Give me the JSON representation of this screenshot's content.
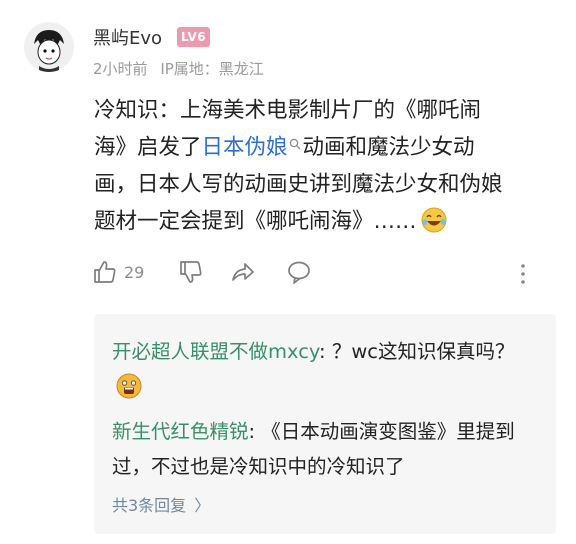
{
  "comment": {
    "username": "黑屿Evo",
    "level_badge": "LV6",
    "time": "2小时前",
    "ip_location": "IP属地：黑龙江",
    "body_pre": "冷知识：上海美术电影制片厂的《哪吒闹海》启发了",
    "body_link": "日本伪娘",
    "body_post": "动画和魔法少女动画，日本人写的动画史讲到魔法少女和伪娘题材一定会提到《哪吒闹海》……",
    "like_count": "29",
    "emoji_icon": "laughing-tears-emoji"
  },
  "replies": [
    {
      "author": "开必超人联盟不做mxcy",
      "separator": ": ",
      "text": "？wc这知识保真吗？",
      "emoji_icon": "shocked-face-emoji"
    },
    {
      "author": "新生代红色精锐",
      "separator": ": ",
      "text": "《日本动画演变图鉴》里提到过，不过也是冷知识中的冷知识了"
    }
  ],
  "view_more_label": "共3条回复",
  "icons": {
    "like": "thumbs-up-icon",
    "dislike": "thumbs-down-icon",
    "share": "share-arrow-icon",
    "reply": "speech-bubble-icon",
    "more": "more-vertical-icon",
    "link_search": "search-icon"
  },
  "colors": {
    "badge": "#ec9ab0",
    "link": "#2f6fc4",
    "reply_author": "#3a8f6a",
    "reply_bg": "#f6f6f6"
  }
}
